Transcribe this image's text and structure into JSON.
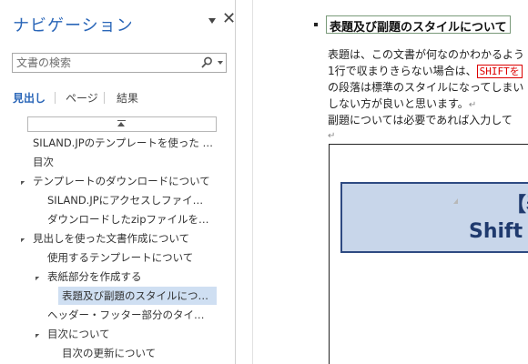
{
  "nav": {
    "title": "ナビゲーション",
    "close_glyph": "✕",
    "search_placeholder": "文書の検索",
    "tabs": [
      {
        "label": "見出し",
        "active": true
      },
      {
        "label": "ページ",
        "active": false
      },
      {
        "label": "結果",
        "active": false
      }
    ],
    "tree": [
      {
        "label": "SILAND.JPのテンプレートを使った 操…",
        "level": 1,
        "expanded": false,
        "selected": false
      },
      {
        "label": "目次",
        "level": 1,
        "expanded": false,
        "selected": false
      },
      {
        "label": "テンプレートのダウンロードについて",
        "level": 1,
        "expanded": true,
        "selected": false
      },
      {
        "label": "SILAND.JPにアクセスしファイルをダ…",
        "level": 2,
        "expanded": false,
        "selected": false
      },
      {
        "label": "ダウンロードしたzipファイルを展開する",
        "level": 2,
        "expanded": false,
        "selected": false
      },
      {
        "label": "見出しを使った文書作成について",
        "level": 1,
        "expanded": true,
        "selected": false
      },
      {
        "label": "使用するテンプレートについて",
        "level": 2,
        "expanded": false,
        "selected": false
      },
      {
        "label": "表紙部分を作成する",
        "level": 2,
        "expanded": true,
        "selected": false
      },
      {
        "label": "表題及び副題のスタイルについて",
        "level": 3,
        "expanded": false,
        "selected": true
      },
      {
        "label": "ヘッダー・フッター部分のタイトルを設…",
        "level": 2,
        "expanded": false,
        "selected": false
      },
      {
        "label": "目次について",
        "level": 2,
        "expanded": true,
        "selected": false
      },
      {
        "label": "目次の更新について",
        "level": 3,
        "expanded": false,
        "selected": false
      }
    ]
  },
  "document": {
    "heading": "表題及び副題のスタイルについて",
    "paragraphs": [
      "表題は、この文書が何なのかわかるよう",
      "1行で収まりきらない場合は、",
      "の段落は標準のスタイルになってしまい",
      "しない方が良いと思います。",
      "副題については必要であれば入力して"
    ],
    "shift_key": "SHIFTを",
    "para_mark": "↵",
    "cover_line1": "【表",
    "cover_line2": "Shift"
  },
  "colors": {
    "nav_title": "#2a66b8",
    "selected_bg": "#cfdff2",
    "cover_fill": "#c8d6ea",
    "cover_border": "#2e4a82",
    "cover_text": "#1f3a6e",
    "shift_red": "#d00000"
  }
}
